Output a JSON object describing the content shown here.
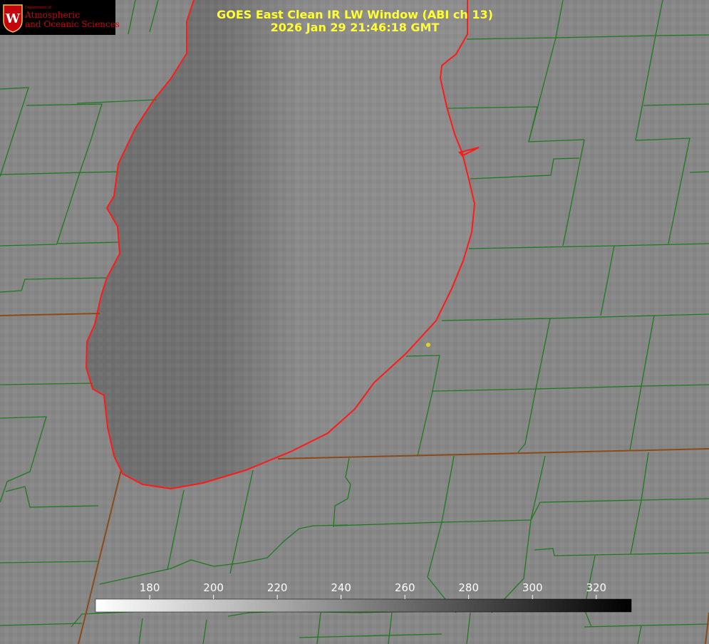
{
  "title": {
    "line1": "GOES East Clean IR LW Window (ABI ch 13)",
    "line2": "2026 Jan 29 21:46:18 GMT"
  },
  "logo": {
    "small_text": "Department of",
    "line1": "Atmospheric",
    "line2": "and Oceanic Sciences",
    "crest_letter": "W"
  },
  "colorbar": {
    "ticks": [
      "180",
      "200",
      "220",
      "240",
      "260",
      "280",
      "300",
      "320"
    ],
    "range": [
      163,
      331
    ],
    "tick_values": [
      180,
      200,
      220,
      240,
      260,
      280,
      300,
      320
    ],
    "gradient": "white-to-black"
  },
  "colors": {
    "coastline": "#ff1a1a",
    "county_lines": "#1e7a1e",
    "state_lines": "#8b4a1a",
    "title": "#ffff33",
    "marker": "#e6d21e",
    "logo_red": "#c5050c"
  }
}
